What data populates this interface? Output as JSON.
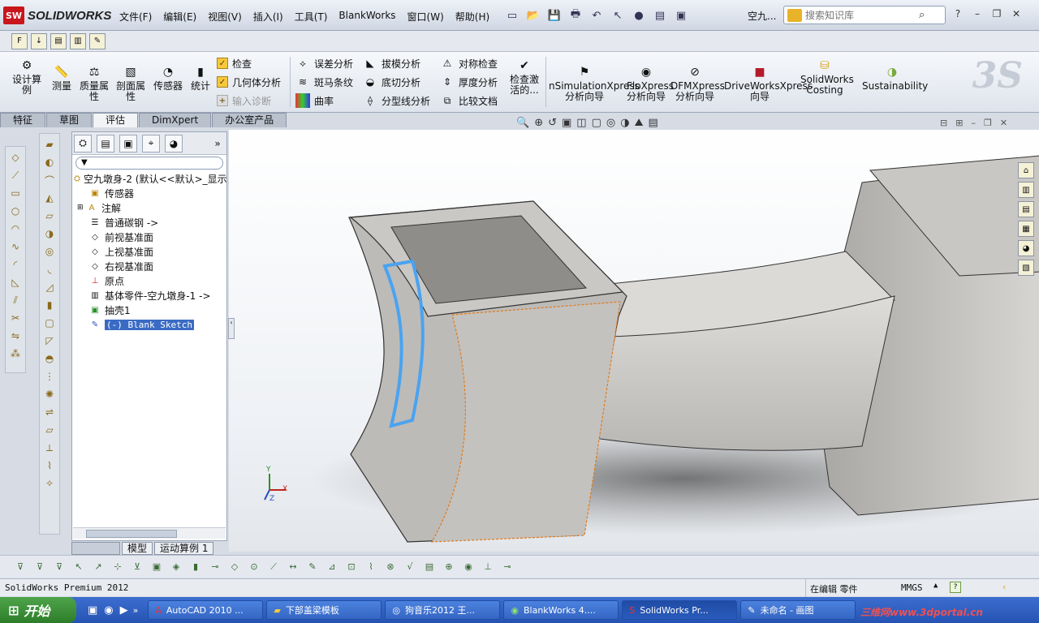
{
  "app": {
    "brand": "SOLIDWORKS",
    "brand_badge": "SW",
    "document_short": "空九..."
  },
  "menubar": [
    "文件(F)",
    "编辑(E)",
    "视图(V)",
    "插入(I)",
    "工具(T)",
    "BlankWorks",
    "窗口(W)",
    "帮助(H)"
  ],
  "search": {
    "placeholder": "搜索知识库"
  },
  "ribbon": {
    "design_calc": "设计算例",
    "measure": "测量",
    "mass_props": "质量属性",
    "section_props": "剖面属性",
    "sensor": "传感器",
    "statistics": "统计",
    "check": "检查",
    "geometry_analysis": "几何体分析",
    "import_diag": "输入诊断",
    "deviation": "误差分析",
    "zebra": "斑马条纹",
    "curvature": "曲率",
    "draft": "拔模分析",
    "undercut": "底切分析",
    "parting_line": "分型线分析",
    "symmetry": "对称检查",
    "thickness": "厚度分析",
    "compare": "比较文档",
    "check_active": "检查激活的...",
    "simxpress": "nSimulationXpress分析向导",
    "floxpress": "FloXpress分析向导",
    "dfmxpress": "DFMXpress分析向导",
    "driveworks": "DriveWorksXpress向导",
    "costing": "SolidWorks Costing",
    "sustainability": "Sustainability"
  },
  "tabs": [
    "特征",
    "草图",
    "评估",
    "DimXpert",
    "办公室产品"
  ],
  "active_tab": "评估",
  "feature_tree": {
    "root": "空九墩身-2  (默认<<默认>_显示",
    "items": [
      "传感器",
      "注解",
      "普通碳钢 ->",
      "前视基准面",
      "上视基准面",
      "右视基准面",
      "原点",
      "基体零件-空九墩身-1 ->",
      "抽壳1",
      "(-) Blank Sketch"
    ]
  },
  "bottom_tabs": [
    "模型",
    "运动算例 1"
  ],
  "status": {
    "product": "SolidWorks Premium 2012",
    "mode": "在编辑 零件",
    "units": "MMGS"
  },
  "taskbar": {
    "start": "开始",
    "buttons": [
      "AutoCAD 2010 ...",
      "下部盖梁模板",
      "狗音乐2012 王...",
      "BlankWorks 4....",
      "SolidWorks Pr...",
      "未命名 - 画图"
    ]
  },
  "watermark": "三维网www.3dportal.cn",
  "triad": {
    "x": "X",
    "y": "Y",
    "z": "Z"
  },
  "colors": {
    "selection": "#4aa3f0",
    "edge_highlight": "#e07a1a",
    "model_face": "#c9c7c4"
  }
}
